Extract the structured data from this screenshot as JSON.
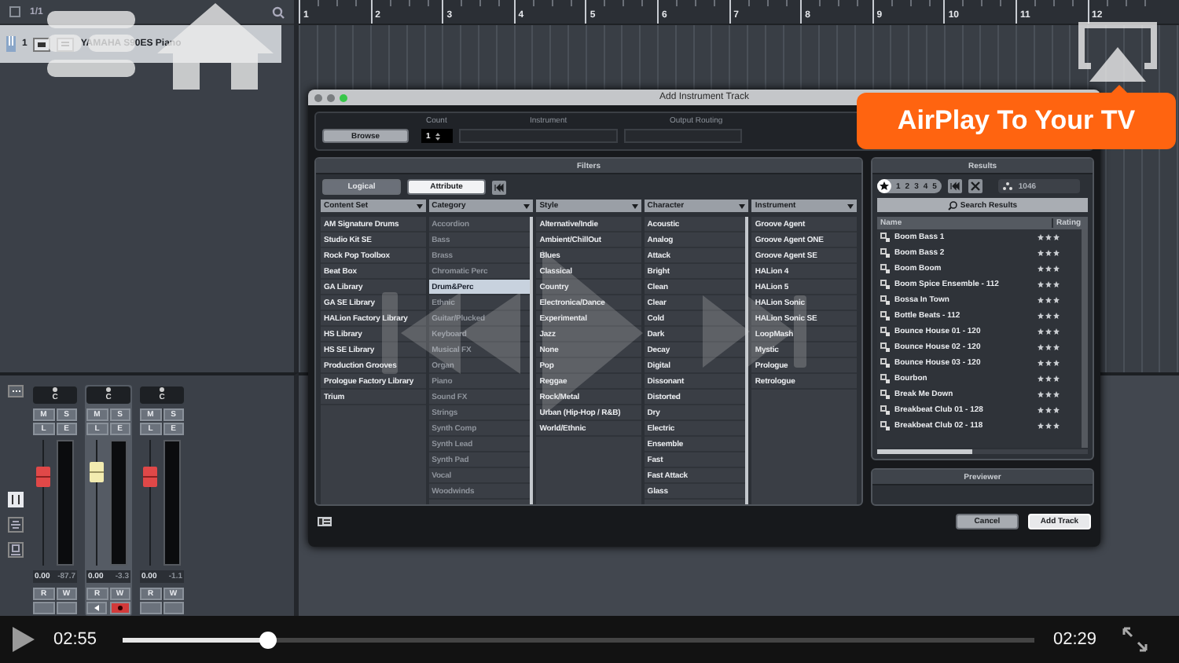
{
  "project": {
    "page": "1/1",
    "ruler": [
      "1",
      "2",
      "3",
      "4",
      "5",
      "6",
      "7",
      "8",
      "9",
      "10",
      "11",
      "12"
    ],
    "track": {
      "number": "1",
      "name": "YAMAHA S90ES Piano"
    }
  },
  "mixer": {
    "strips": [
      {
        "pan": "C",
        "buttons": [
          "M",
          "S",
          "L",
          "E"
        ],
        "auto": [
          "R",
          "W"
        ],
        "volume": "0.00",
        "peak": "-87.7",
        "level": 0.76,
        "selected": false,
        "record": false
      },
      {
        "pan": "C",
        "buttons": [
          "M",
          "S",
          "L",
          "E"
        ],
        "auto": [
          "R",
          "W"
        ],
        "volume": "0.00",
        "peak": "-3.3",
        "level": 0.8,
        "selected": true,
        "record": true
      },
      {
        "pan": "C",
        "buttons": [
          "M",
          "S",
          "L",
          "E"
        ],
        "auto": [
          "R",
          "W"
        ],
        "volume": "0.00",
        "peak": "-1.1",
        "level": 0.76,
        "selected": false,
        "record": false
      }
    ]
  },
  "dialog": {
    "title": "Add Instrument Track",
    "fields": {
      "labels": [
        "Count",
        "Instrument",
        "Output Routing"
      ],
      "browse": "Browse",
      "count": "1"
    },
    "filters": {
      "title": "Filters",
      "tabs": [
        {
          "label": "Logical",
          "selected": false
        },
        {
          "label": "Attribute",
          "selected": true
        }
      ],
      "columns": [
        {
          "header": "Content Set",
          "items": [
            {
              "label": "AM Signature Drums",
              "selected": false,
              "disabled": false
            },
            {
              "label": "Studio Kit SE",
              "selected": false,
              "disabled": false
            },
            {
              "label": "Rock Pop Toolbox",
              "selected": false,
              "disabled": false
            },
            {
              "label": "Beat Box",
              "selected": false,
              "disabled": false
            },
            {
              "label": "GA Library",
              "selected": false,
              "disabled": false
            },
            {
              "label": "GA SE Library",
              "selected": false,
              "disabled": false
            },
            {
              "label": "HALion Factory Library",
              "selected": false,
              "disabled": false
            },
            {
              "label": "HS Library",
              "selected": false,
              "disabled": false
            },
            {
              "label": "HS SE Library",
              "selected": false,
              "disabled": false
            },
            {
              "label": "Production Grooves",
              "selected": false,
              "disabled": false
            },
            {
              "label": "Prologue Factory Library",
              "selected": false,
              "disabled": false
            },
            {
              "label": "Trium",
              "selected": false,
              "disabled": false
            }
          ]
        },
        {
          "header": "Category",
          "items": [
            {
              "label": "Accordion",
              "selected": false,
              "disabled": true
            },
            {
              "label": "Bass",
              "selected": false,
              "disabled": true
            },
            {
              "label": "Brass",
              "selected": false,
              "disabled": true
            },
            {
              "label": "Chromatic Perc",
              "selected": false,
              "disabled": true
            },
            {
              "label": "Drum&Perc",
              "selected": true,
              "disabled": false
            },
            {
              "label": "Ethnic",
              "selected": false,
              "disabled": true
            },
            {
              "label": "Guitar/Plucked",
              "selected": false,
              "disabled": true
            },
            {
              "label": "Keyboard",
              "selected": false,
              "disabled": true
            },
            {
              "label": "Musical FX",
              "selected": false,
              "disabled": true
            },
            {
              "label": "Organ",
              "selected": false,
              "disabled": true
            },
            {
              "label": "Piano",
              "selected": false,
              "disabled": true
            },
            {
              "label": "Sound FX",
              "selected": false,
              "disabled": true
            },
            {
              "label": "Strings",
              "selected": false,
              "disabled": true
            },
            {
              "label": "Synth Comp",
              "selected": false,
              "disabled": true
            },
            {
              "label": "Synth Lead",
              "selected": false,
              "disabled": true
            },
            {
              "label": "Synth Pad",
              "selected": false,
              "disabled": true
            },
            {
              "label": "Vocal",
              "selected": false,
              "disabled": true
            },
            {
              "label": "Woodwinds",
              "selected": false,
              "disabled": true
            }
          ]
        },
        {
          "header": "Style",
          "items": [
            {
              "label": "Alternative/Indie",
              "selected": false,
              "disabled": false
            },
            {
              "label": "Ambient/ChillOut",
              "selected": false,
              "disabled": false
            },
            {
              "label": "Blues",
              "selected": false,
              "disabled": false
            },
            {
              "label": "Classical",
              "selected": false,
              "disabled": false
            },
            {
              "label": "Country",
              "selected": false,
              "disabled": false
            },
            {
              "label": "Electronica/Dance",
              "selected": false,
              "disabled": false
            },
            {
              "label": "Experimental",
              "selected": false,
              "disabled": false
            },
            {
              "label": "Jazz",
              "selected": false,
              "disabled": false
            },
            {
              "label": "None",
              "selected": false,
              "disabled": false
            },
            {
              "label": "Pop",
              "selected": false,
              "disabled": false
            },
            {
              "label": "Reggae",
              "selected": false,
              "disabled": false
            },
            {
              "label": "Rock/Metal",
              "selected": false,
              "disabled": false
            },
            {
              "label": "Urban (Hip-Hop / R&B)",
              "selected": false,
              "disabled": false
            },
            {
              "label": "World/Ethnic",
              "selected": false,
              "disabled": false
            }
          ]
        },
        {
          "header": "Character",
          "items": [
            {
              "label": "Acoustic",
              "selected": false,
              "disabled": false
            },
            {
              "label": "Analog",
              "selected": false,
              "disabled": false
            },
            {
              "label": "Attack",
              "selected": false,
              "disabled": false
            },
            {
              "label": "Bright",
              "selected": false,
              "disabled": false
            },
            {
              "label": "Clean",
              "selected": false,
              "disabled": false
            },
            {
              "label": "Clear",
              "selected": false,
              "disabled": false
            },
            {
              "label": "Cold",
              "selected": false,
              "disabled": false
            },
            {
              "label": "Dark",
              "selected": false,
              "disabled": false
            },
            {
              "label": "Decay",
              "selected": false,
              "disabled": false
            },
            {
              "label": "Digital",
              "selected": false,
              "disabled": false
            },
            {
              "label": "Dissonant",
              "selected": false,
              "disabled": false
            },
            {
              "label": "Distorted",
              "selected": false,
              "disabled": false
            },
            {
              "label": "Dry",
              "selected": false,
              "disabled": false
            },
            {
              "label": "Electric",
              "selected": false,
              "disabled": false
            },
            {
              "label": "Ensemble",
              "selected": false,
              "disabled": false
            },
            {
              "label": "Fast",
              "selected": false,
              "disabled": false
            },
            {
              "label": "Fast Attack",
              "selected": false,
              "disabled": false
            },
            {
              "label": "Glass",
              "selected": false,
              "disabled": false
            }
          ]
        },
        {
          "header": "Instrument",
          "items": [
            {
              "label": "Groove Agent",
              "selected": false,
              "disabled": false
            },
            {
              "label": "Groove Agent ONE",
              "selected": false,
              "disabled": false
            },
            {
              "label": "Groove Agent SE",
              "selected": false,
              "disabled": false
            },
            {
              "label": "HALion 4",
              "selected": false,
              "disabled": false
            },
            {
              "label": "HALion 5",
              "selected": false,
              "disabled": false
            },
            {
              "label": "HALion Sonic",
              "selected": false,
              "disabled": false
            },
            {
              "label": "HALion Sonic SE",
              "selected": false,
              "disabled": false
            },
            {
              "label": "LoopMash",
              "selected": false,
              "disabled": false
            },
            {
              "label": "Mystic",
              "selected": false,
              "disabled": false
            },
            {
              "label": "Prologue",
              "selected": false,
              "disabled": false
            },
            {
              "label": "Retrologue",
              "selected": false,
              "disabled": false
            }
          ]
        }
      ]
    },
    "results": {
      "title": "Results",
      "ratings": [
        "1",
        "2",
        "3",
        "4",
        "5"
      ],
      "count": "1046",
      "search": "Search Results",
      "columns": [
        "Name",
        "Rating"
      ],
      "rows": [
        {
          "name": "Boom Bass 1",
          "stars": 3
        },
        {
          "name": "Boom Bass 2",
          "stars": 3
        },
        {
          "name": "Boom Boom",
          "stars": 3
        },
        {
          "name": "Boom Spice Ensemble - 112",
          "stars": 3
        },
        {
          "name": "Bossa In Town",
          "stars": 3
        },
        {
          "name": "Bottle Beats - 112",
          "stars": 3
        },
        {
          "name": "Bounce House 01 - 120",
          "stars": 3
        },
        {
          "name": "Bounce House 02 - 120",
          "stars": 3
        },
        {
          "name": "Bounce House 03 - 120",
          "stars": 3
        },
        {
          "name": "Bourbon",
          "stars": 3
        },
        {
          "name": "Break Me Down",
          "stars": 3
        },
        {
          "name": "Breakbeat Club 01 - 128",
          "stars": 3
        },
        {
          "name": "Breakbeat Club 02 - 118",
          "stars": 3
        }
      ]
    },
    "previewer": "Previewer",
    "buttons": [
      {
        "label": "Cancel",
        "default": false
      },
      {
        "label": "Add Track",
        "default": true
      }
    ]
  },
  "airplay_tip": "AirPlay To Your TV",
  "player": {
    "elapsed": "02:55",
    "remaining": "02:29",
    "level": 0.16
  }
}
